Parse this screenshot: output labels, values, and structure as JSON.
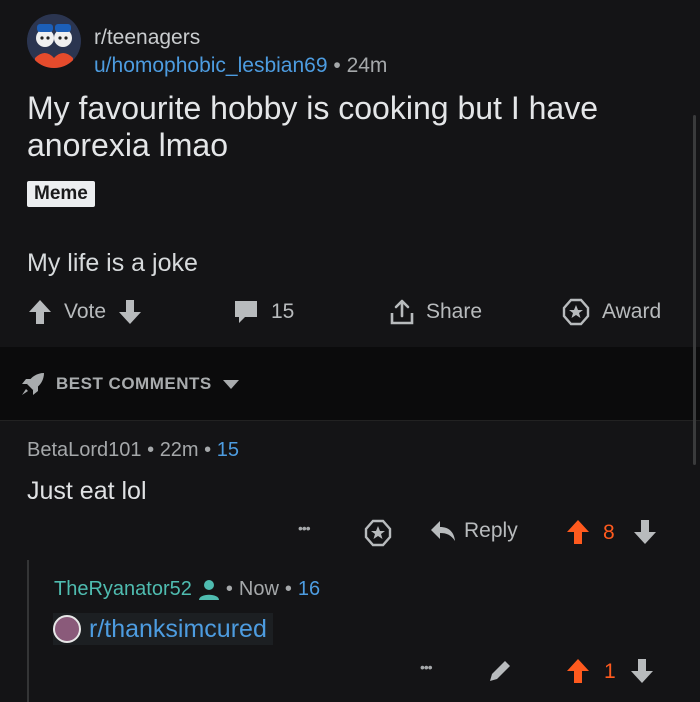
{
  "post": {
    "subreddit": "r/teenagers",
    "author": "u/homophobic_lesbian69",
    "separator": "•",
    "age": "24m",
    "title": "My favourite hobby is cooking but I have anorexia lmao",
    "flair": "Meme",
    "body": "My life is a joke",
    "actions": {
      "vote_label": "Vote",
      "comment_count": "15",
      "share_label": "Share",
      "award_label": "Award"
    }
  },
  "sort": {
    "label": "BEST COMMENTS"
  },
  "comments": [
    {
      "author": "BetaLord101",
      "separator": "•",
      "age": "22m",
      "score_badge": "15",
      "text": "Just eat lol",
      "more_label": "•••",
      "reply_label": "Reply",
      "score": "8"
    },
    {
      "author": "TheRyanator52",
      "separator": "•",
      "age": "Now",
      "score_badge": "16",
      "link_text": "r/thanksimcured",
      "more_label": "•••",
      "score": "1"
    }
  ],
  "colors": {
    "background": "#141416",
    "upvote_active": "#ff5a1e",
    "link_blue": "#4d9ce0",
    "op_teal": "#4fbcb0"
  }
}
